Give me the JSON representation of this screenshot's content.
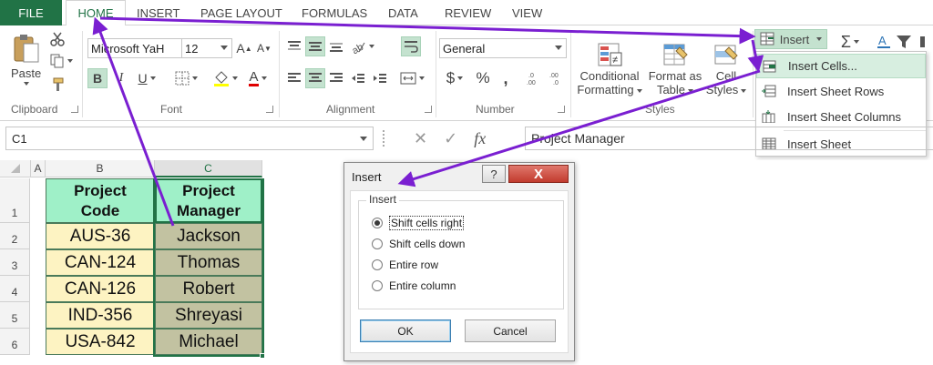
{
  "tabs": [
    "FILE",
    "HOME",
    "INSERT",
    "PAGE LAYOUT",
    "FORMULAS",
    "DATA",
    "REVIEW",
    "VIEW"
  ],
  "ribbon": {
    "clipboard": {
      "paste": "Paste",
      "label": "Clipboard"
    },
    "font": {
      "name": "Microsoft YaH",
      "size": "12",
      "label": "Font",
      "bold": "B",
      "italic": "I",
      "underline": "U",
      "grow": "A",
      "shrink": "A",
      "fontcolor": "A"
    },
    "alignment": {
      "label": "Alignment"
    },
    "number": {
      "format": "General",
      "currency": "$",
      "percent": "%",
      "comma": ",",
      "label": "Number"
    },
    "styles": {
      "conditional1": "Conditional",
      "conditional2": "Formatting",
      "format1": "Format as",
      "format2": "Table",
      "cell1": "Cell",
      "cell2": "Styles",
      "label": "Styles"
    },
    "cells": {
      "insert": "Insert"
    },
    "editing": {
      "sum": "Σ"
    }
  },
  "insert_menu": [
    "Insert Cells...",
    "Insert Sheet Rows",
    "Insert Sheet Columns",
    "Insert Sheet"
  ],
  "formula_bar": {
    "name_box": "C1",
    "fx": "fx",
    "content": "Project Manager"
  },
  "grid": {
    "col_headers": [
      "A",
      "B",
      "C"
    ],
    "row_headers": [
      "1",
      "2",
      "3",
      "4",
      "5",
      "6"
    ],
    "header_row": {
      "b1": "Project",
      "b2": "Code",
      "c1": "Project",
      "c2": "Manager"
    },
    "rows": [
      {
        "code": "AUS-36",
        "manager": "Jackson"
      },
      {
        "code": "CAN-124",
        "manager": "Thomas"
      },
      {
        "code": "CAN-126",
        "manager": "Robert"
      },
      {
        "code": "IND-356",
        "manager": "Shreyasi"
      },
      {
        "code": "USA-842",
        "manager": "Michael"
      }
    ]
  },
  "dialog": {
    "title": "Insert",
    "help": "?",
    "close": "X",
    "group_label": "Insert",
    "options": [
      "Shift cells right",
      "Shift cells down",
      "Entire row",
      "Entire column"
    ],
    "selected_option": 0,
    "ok": "OK",
    "cancel": "Cancel"
  },
  "colors": {
    "excel_green": "#217346",
    "header_fill": "#9ff0c8",
    "code_fill": "#fdf3c2",
    "manager_fill": "#c2c2a1",
    "arrow": "#7a1fd1"
  }
}
